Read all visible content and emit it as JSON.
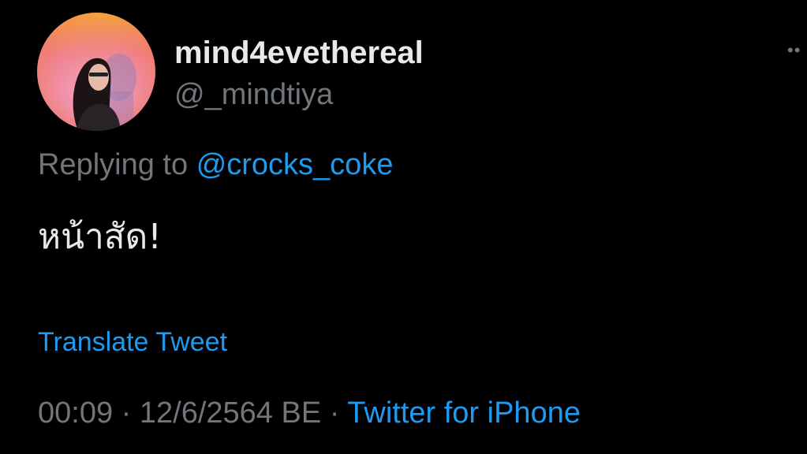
{
  "tweet": {
    "display_name": "mind4evethereal",
    "handle": "@_mindtiya",
    "reply_prefix": "Replying to",
    "reply_to": "@crocks_coke",
    "text": "หน้าสัด!",
    "translate_label": "Translate Tweet",
    "time": "00:09",
    "separator": "·",
    "date": "12/6/2564 BE",
    "source": "Twitter for iPhone",
    "more_icon": "more-options-icon"
  },
  "colors": {
    "background": "#000000",
    "link": "#1d9bf0",
    "muted": "#71767b",
    "text": "#e7e9ea"
  }
}
